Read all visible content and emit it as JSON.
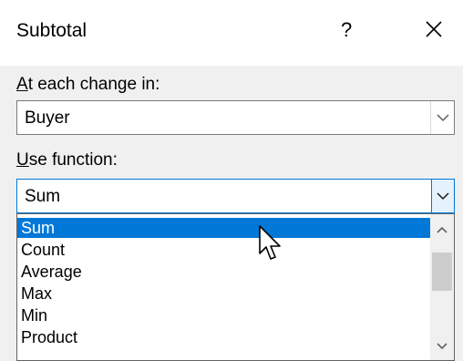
{
  "dialog": {
    "title": "Subtotal",
    "help": "?",
    "close_icon": "close-icon"
  },
  "change_field": {
    "label_key": "A",
    "label_rest": "t each change in:",
    "value": "Buyer"
  },
  "function_field": {
    "label_key": "U",
    "label_rest": "se function:",
    "value": "Sum",
    "options": [
      "Sum",
      "Count",
      "Average",
      "Max",
      "Min",
      "Product"
    ],
    "selected_index": 0
  },
  "colors": {
    "accent": "#0078d7",
    "dialog_bg": "#f0f0f0"
  }
}
